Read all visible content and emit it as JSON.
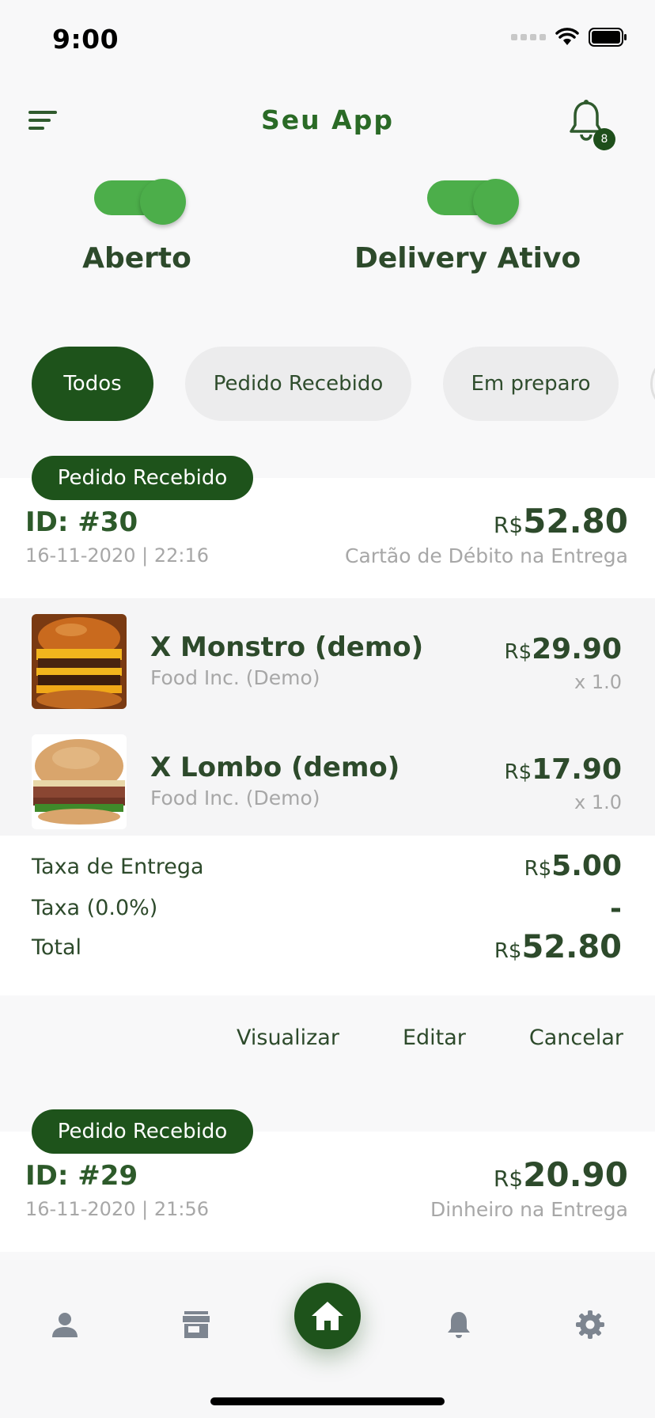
{
  "status_bar": {
    "time": "9:00"
  },
  "header": {
    "title": "Seu App",
    "notification_count": "8"
  },
  "toggles": [
    {
      "label": "Aberto",
      "on": true
    },
    {
      "label": "Delivery Ativo",
      "on": true
    }
  ],
  "filters": [
    {
      "label": "Todos",
      "active": true
    },
    {
      "label": "Pedido Recebido",
      "active": false
    },
    {
      "label": "Em preparo",
      "active": false
    }
  ],
  "orders": [
    {
      "status": "Pedido Recebido",
      "id": "ID: #30",
      "date": "16-11-2020 | 22:16",
      "currency": "R$",
      "total": "52.80",
      "payment": "Cartão de Débito na Entrega",
      "items": [
        {
          "name": "X Monstro (demo)",
          "vendor": "Food Inc. (Demo)",
          "currency": "R$",
          "price": "29.90",
          "qty": "x 1.0"
        },
        {
          "name": "X Lombo (demo)",
          "vendor": "Food Inc. (Demo)",
          "currency": "R$",
          "price": "17.90",
          "qty": "x 1.0"
        }
      ],
      "summary": {
        "delivery_label": "Taxa de Entrega",
        "delivery_currency": "R$",
        "delivery_value": "5.00",
        "tax_label": "Taxa (0.0%)",
        "tax_value": "-",
        "total_label": "Total",
        "total_currency": "R$",
        "total_value": "52.80"
      },
      "actions": {
        "view": "Visualizar",
        "edit": "Editar",
        "cancel": "Cancelar"
      }
    },
    {
      "status": "Pedido Recebido",
      "id": "ID: #29",
      "date": "16-11-2020 | 21:56",
      "currency": "R$",
      "total": "20.90",
      "payment": "Dinheiro na Entrega"
    }
  ],
  "bottom_nav": {
    "items": [
      {
        "icon": "person-icon"
      },
      {
        "icon": "store-icon"
      },
      {
        "icon": "home-icon",
        "active": true
      },
      {
        "icon": "bell-icon"
      },
      {
        "icon": "gear-icon"
      }
    ]
  },
  "colors": {
    "brand_dark": "#1e531b",
    "toggle_green": "#4cae4a",
    "title_green": "#2a6a26"
  }
}
